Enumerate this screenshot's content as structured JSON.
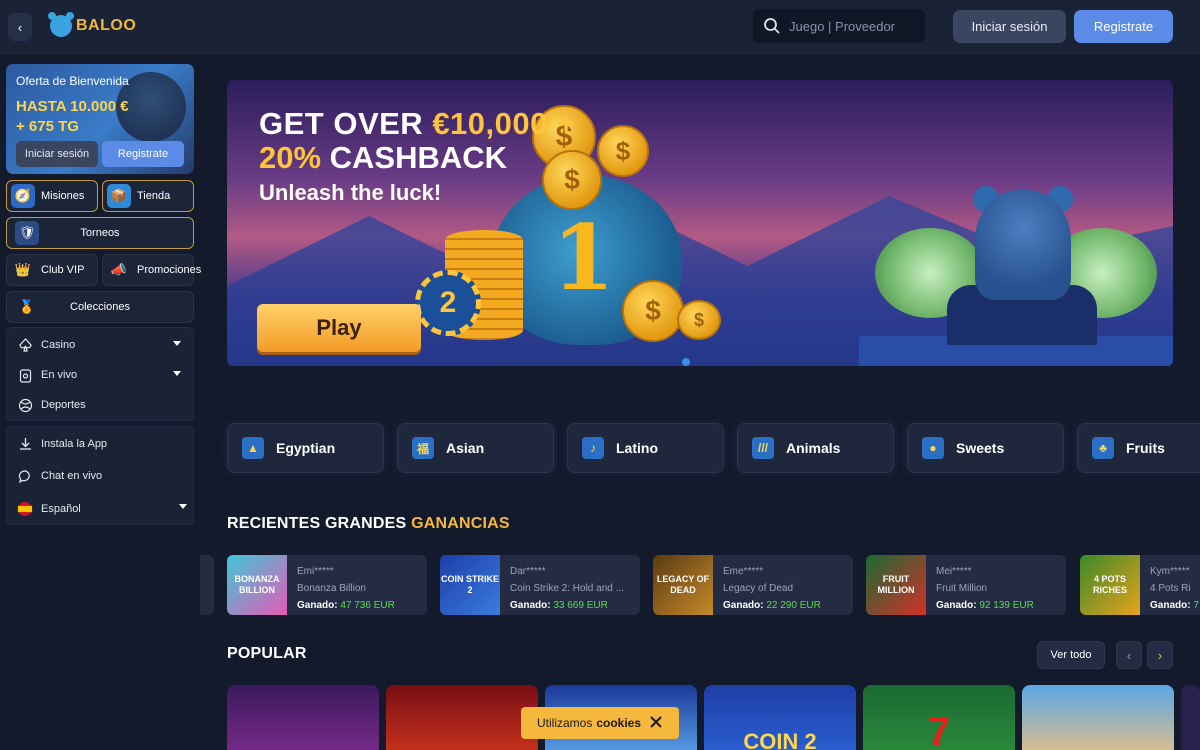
{
  "header": {
    "brand": "BALOO",
    "search_placeholder": "Juego | Proveedor",
    "login_label": "Iniciar sesión",
    "register_label": "Registrate"
  },
  "sidebar": {
    "promo": {
      "title": "Oferta de Bienvenida",
      "amount_line1": "HASTA 10.000 €",
      "amount_line2": "+ 675 TG",
      "login_label": "Iniciar sesión",
      "register_label": "Registrate"
    },
    "tiles": {
      "misiones": "Misiones",
      "tienda": "Tienda",
      "torneos": "Torneos",
      "club_vip": "Club VIP",
      "promociones": "Promociones",
      "colecciones": "Colecciones"
    },
    "nav": {
      "casino": "Casino",
      "en_vivo": "En vivo",
      "deportes": "Deportes",
      "instala_app": "Instala la App",
      "chat": "Chat en vivo",
      "language": "Español"
    }
  },
  "banner": {
    "line1_prefix": "GET OVER ",
    "line1_highlight": "€10,000 +",
    "line2_highlight": "20%",
    "line2_rest": " CASHBACK",
    "line3": "Unleash the luck!",
    "play_label": "Play"
  },
  "categories": [
    "Egyptian",
    "Asian",
    "Latino",
    "Animals",
    "Sweets",
    "Fruits"
  ],
  "recent_wins": {
    "title_white": "RECIENTES GRANDES ",
    "title_gold": "GANANCIAS",
    "won_label": "Ganado:",
    "items": [
      {
        "user": "Emi*****",
        "game": "Bonanza Billion",
        "amount": "47 736 EUR",
        "thumb": "BONANZA BILLION"
      },
      {
        "user": "Dar*****",
        "game": "Coin Strike 2: Hold and ...",
        "amount": "33 669 EUR",
        "thumb": "COIN STRIKE 2"
      },
      {
        "user": "Eme*****",
        "game": "Legacy of Dead",
        "amount": "22 290 EUR",
        "thumb": "LEGACY OF DEAD"
      },
      {
        "user": "Mei*****",
        "game": "Fruit Million",
        "amount": "92 139 EUR",
        "thumb": "FRUIT MILLION"
      },
      {
        "user": "Kym*****",
        "game": "4 Pots Ri",
        "amount": "7",
        "thumb": "4 POTS RICHES"
      }
    ]
  },
  "popular": {
    "title": "POPULAR",
    "see_all": "Ver todo",
    "tiles": [
      "",
      "",
      "",
      "COIN 2",
      "7",
      ""
    ]
  },
  "cookie": {
    "text": "Utilizamos",
    "bold": "cookies"
  },
  "colors": {
    "accent_blue": "#5b8be6",
    "gold": "#f6b73c",
    "win_green": "#5fd65a",
    "bg": "#131a2b"
  }
}
